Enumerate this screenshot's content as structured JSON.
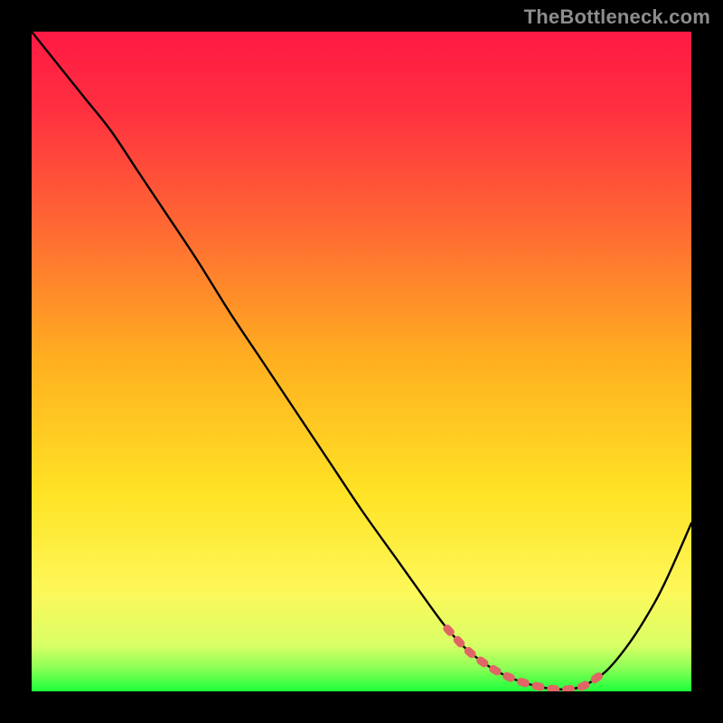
{
  "watermark": "TheBottleneck.com",
  "chart_data": {
    "type": "line",
    "title": "",
    "xlabel": "",
    "ylabel": "",
    "xlim": [
      0,
      100
    ],
    "ylim": [
      0,
      100
    ],
    "grid": false,
    "legend": false,
    "gradient_stops": [
      {
        "offset": 0.0,
        "color": "#ff1a44"
      },
      {
        "offset": 0.12,
        "color": "#ff3040"
      },
      {
        "offset": 0.3,
        "color": "#ff6a33"
      },
      {
        "offset": 0.5,
        "color": "#ffb020"
      },
      {
        "offset": 0.7,
        "color": "#ffe325"
      },
      {
        "offset": 0.85,
        "color": "#fdf85a"
      },
      {
        "offset": 0.93,
        "color": "#d9ff66"
      },
      {
        "offset": 0.965,
        "color": "#8bff55"
      },
      {
        "offset": 1.0,
        "color": "#1bff3a"
      }
    ],
    "series": [
      {
        "name": "bottleneck-curve",
        "color": "#000000",
        "x": [
          0.0,
          4,
          8,
          12,
          16,
          20,
          25,
          30,
          35,
          40,
          45,
          50,
          55,
          60,
          63,
          66,
          69,
          71,
          73,
          75,
          78,
          80,
          82,
          84,
          87,
          90,
          93,
          96,
          100
        ],
        "y": [
          100,
          95,
          90,
          85,
          79,
          73,
          65.5,
          57.5,
          50,
          42.5,
          35,
          27.5,
          20.5,
          13.5,
          9.5,
          6.3,
          4.0,
          2.8,
          1.9,
          1.2,
          0.5,
          0.3,
          0.4,
          1.0,
          3.0,
          6.5,
          11.0,
          16.5,
          25.5
        ]
      },
      {
        "name": "sweet-spot-highlight",
        "color": "#e06666",
        "x": [
          63,
          66,
          69,
          71,
          73,
          75,
          78,
          80,
          82,
          84,
          87
        ],
        "y": [
          9.5,
          6.3,
          4.0,
          2.8,
          1.9,
          1.2,
          0.5,
          0.3,
          0.4,
          1.0,
          3.0
        ]
      }
    ]
  }
}
